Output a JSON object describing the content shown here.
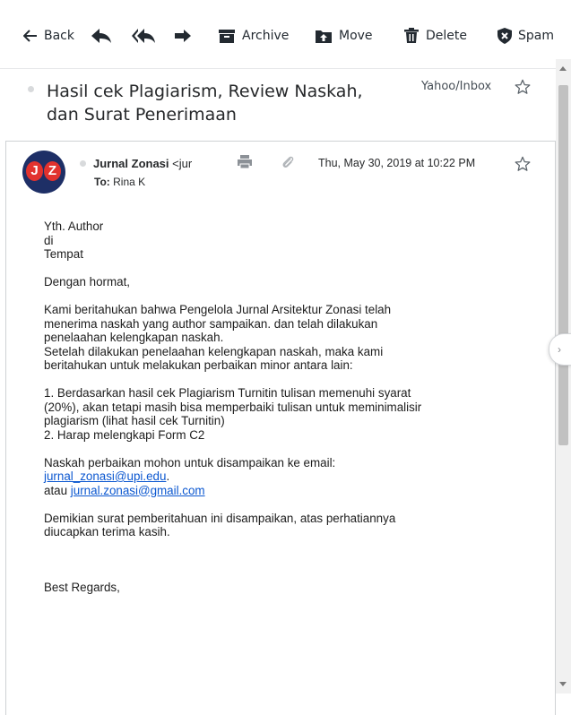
{
  "toolbar": {
    "back_label": "Back",
    "archive_label": "Archive",
    "move_label": "Move",
    "delete_label": "Delete",
    "spam_label": "Spam"
  },
  "email": {
    "subject_line1": "Hasil cek Plagiarism, Review Naskah,",
    "subject_line2": "dan Surat Penerimaan",
    "folder": "Yahoo/Inbox",
    "avatar_letters": [
      "J",
      "Z"
    ],
    "sender_name": "Jurnal Zonasi",
    "sender_email_partial": "<jur",
    "to_prefix": "To:",
    "recipient": "Rina K",
    "date": "Thu, May 30, 2019 at 10:22 PM"
  },
  "body": {
    "greeting": [
      "Yth. Author",
      "di",
      "Tempat"
    ],
    "opening": "Dengan hormat,",
    "para1": [
      "Kami beritahukan bahwa Pengelola Jurnal Arsitektur Zonasi telah",
      "menerima naskah yang author sampaikan. dan telah dilakukan",
      "penelaahan kelengkapan naskah.",
      "Setelah dilakukan penelaahan kelengkapan naskah, maka kami",
      "beritahukan untuk melakukan perbaikan minor antara lain:"
    ],
    "list": [
      "1.  Berdasarkan hasil cek Plagiarism Turnitin tulisan memenuhi syarat",
      "(20%), akan tetapi masih bisa memperbaiki tulisan untuk meminimalisir",
      "plagiarism (lihat hasil cek Turnitin)",
      "2. Harap melengkapi Form C2"
    ],
    "send_intro": "Naskah perbaikan mohon untuk disampaikan ke email:",
    "email1": "jurnal_zonasi@upi.edu",
    "email1_suffix": ".",
    "or_label": "atau",
    "email2": "jurnal.zonasi@gmail.com",
    "closing": [
      "Demikian surat pemberitahuan ini disampaikan, atas perhatiannya",
      "diucapkan terima kasih."
    ],
    "regards": "Best Regards,"
  },
  "colors": {
    "link": "#0b57d0",
    "avatar_bg": "#1e2f66",
    "avatar_accent": "#e2322e",
    "icon": "#232a31"
  }
}
